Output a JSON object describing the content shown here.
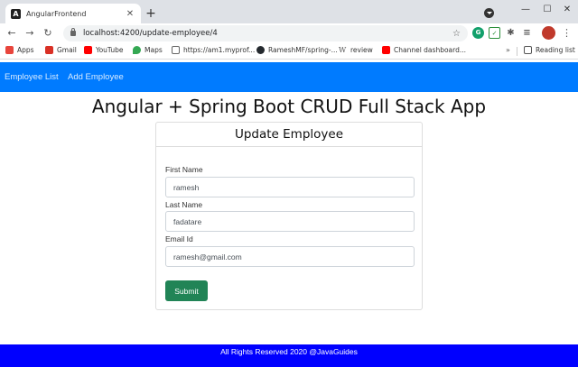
{
  "browser": {
    "tab": {
      "title": "AngularFrontend",
      "favicon": "A",
      "close": "✕"
    },
    "new_tab": "+",
    "window_controls": {
      "minimize": "—",
      "maximize": "☐",
      "close": "✕"
    },
    "nav": {
      "back": "←",
      "forward": "→",
      "reload": "↻"
    },
    "url": "localhost:4200/update-employee/4",
    "star": "☆",
    "menu": "⋮",
    "bookmarks": [
      {
        "label": "Apps",
        "icon": "apps-grid-icon",
        "color": "#e8453c"
      },
      {
        "label": "Gmail",
        "icon": "gmail-icon",
        "color": "#d93025"
      },
      {
        "label": "YouTube",
        "icon": "youtube-icon",
        "color": "#ff0000"
      },
      {
        "label": "Maps",
        "icon": "maps-pin-icon",
        "color": "#34a853"
      },
      {
        "label": "https://am1.myprof...",
        "icon": "mail-icon",
        "color": "#666666"
      },
      {
        "label": "RameshMF/spring-...",
        "icon": "github-icon",
        "color": "#24292e"
      },
      {
        "label": "review",
        "icon": "wikipedia-icon",
        "color": "#555555"
      },
      {
        "label": "Channel dashboard...",
        "icon": "youtube-icon",
        "color": "#ff0000"
      }
    ],
    "bookmarks_more": "»",
    "reading_list": "Reading list"
  },
  "app": {
    "nav_links": [
      "Employee List",
      "Add Employee"
    ],
    "title": "Angular + Spring Boot CRUD Full Stack App",
    "card_title": "Update Employee",
    "fields": [
      {
        "label": "First Name",
        "value": "ramesh"
      },
      {
        "label": "Last Name",
        "value": "fadatare"
      },
      {
        "label": "Email Id",
        "value": "ramesh@gmail.com"
      }
    ],
    "submit_label": "Submit",
    "footer": "All Rights Reserved 2020 @JavaGuides"
  },
  "colors": {
    "navbar": "#007bff",
    "submit": "#218456",
    "footer": "#0000ff"
  }
}
